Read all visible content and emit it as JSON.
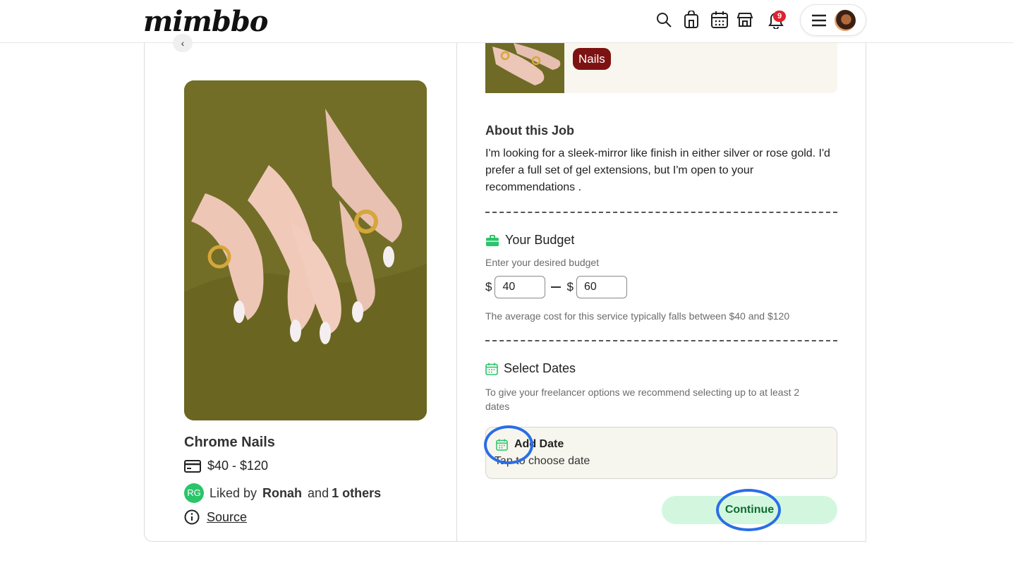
{
  "header": {
    "logo_text": "mimbbo",
    "notifications_count": "9",
    "icons": [
      "search-icon",
      "shop-bag-icon",
      "calendar-icon",
      "store-icon",
      "bell-icon",
      "hamburger-icon",
      "avatar"
    ]
  },
  "listing": {
    "title": "Chrome Nails",
    "price_range": "$40 - $120",
    "liked_initials": "RG",
    "liked_prefix": "Liked by",
    "liked_name": "Ronah",
    "liked_and": "and",
    "liked_others": "1 others",
    "source_label": "Source",
    "tag": "Nails"
  },
  "about": {
    "heading": "About this Job",
    "text": "I'm looking for a sleek-mirror like finish in either silver or rose gold. I'd prefer a full set of gel extensions, but I'm open to your recommendations ."
  },
  "budget": {
    "heading": "Your Budget",
    "hint": "Enter your desired budget",
    "currency": "$",
    "min": "40",
    "max": "60",
    "note": "The average cost for this service typically falls between $40 and $120"
  },
  "dates": {
    "heading": "Select Dates",
    "hint": "To give your freelancer options we recommend selecting up to at least 2 dates",
    "add_title": "Add Date",
    "add_sub": "Tap to choose date"
  },
  "actions": {
    "continue_label": "Continue"
  },
  "colors": {
    "accent_green": "#2ac56a",
    "tag_bg": "#7d1212",
    "continue_bg": "#d2f7de",
    "highlight_circle": "#2a6ee6",
    "badge": "#e0232e"
  }
}
